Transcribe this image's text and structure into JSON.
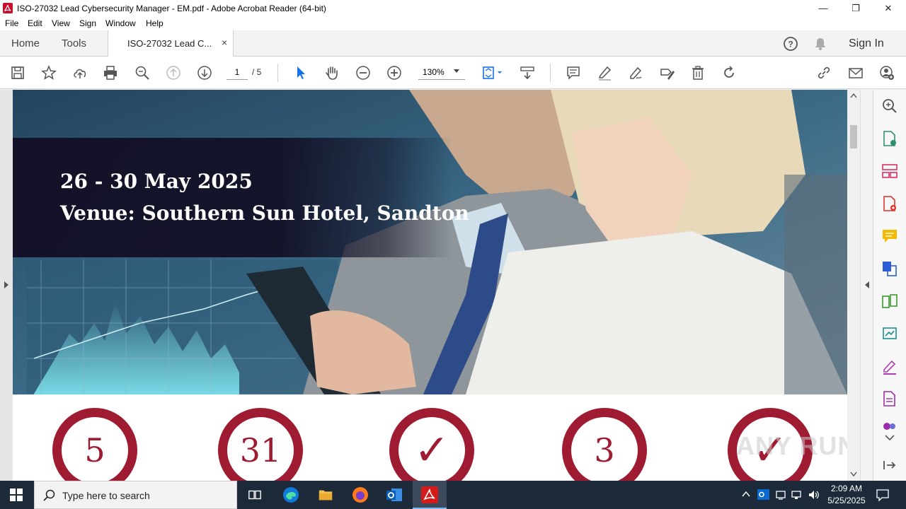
{
  "window": {
    "title": "ISO-27032 Lead Cybersecurity Manager - EM.pdf - Adobe Acrobat Reader (64-bit)",
    "minimize": "—",
    "maximize": "❐",
    "close": "✕"
  },
  "menu": [
    "File",
    "Edit",
    "View",
    "Sign",
    "Window",
    "Help"
  ],
  "tabs": {
    "home": "Home",
    "tools": "Tools",
    "document": "ISO-27032 Lead C...",
    "close": "×",
    "sign_in": "Sign In"
  },
  "toolbar": {
    "current_page": "1",
    "total_pages": "/ 5",
    "zoom": "130%"
  },
  "document": {
    "date": "26 - 30  May 2025",
    "venue": "Venue: Southern Sun Hotel, Sandton",
    "stats": [
      "5",
      "31",
      "✓",
      "3",
      "✓"
    ],
    "accent_color": "#9e1b32"
  },
  "watermark": "ANY RUN",
  "taskbar": {
    "search_placeholder": "Type here to search",
    "time": "2:09 AM",
    "date": "5/25/2025"
  }
}
